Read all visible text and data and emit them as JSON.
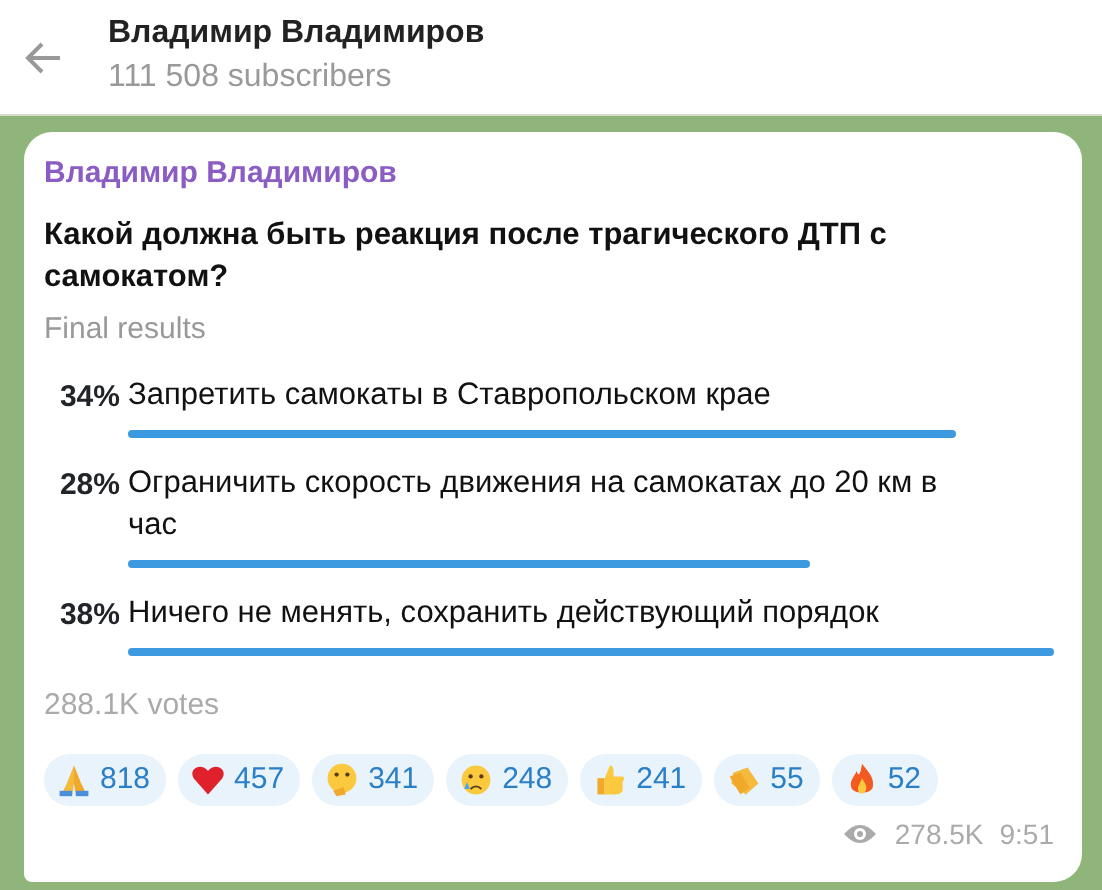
{
  "header": {
    "title": "Владимир Владимиров",
    "subtitle": "111 508 subscribers"
  },
  "message": {
    "author": "Владимир Владимиров",
    "question": "Какой должна быть реакция после трагического ДТП с самокатом?",
    "status": "Final results",
    "options": [
      {
        "percent": "34%",
        "text": "Запретить самокаты в Ставропольском крае"
      },
      {
        "percent": "28%",
        "text": "Ограничить скорость движения на самокатах до 20 км в час"
      },
      {
        "percent": "38%",
        "text": "Ничего не менять, сохранить действующий порядок"
      }
    ],
    "votes": "288.1K votes",
    "reactions": [
      {
        "kind": "pray",
        "count": "818"
      },
      {
        "kind": "heart",
        "count": "457"
      },
      {
        "kind": "thinking",
        "count": "341"
      },
      {
        "kind": "crying",
        "count": "248"
      },
      {
        "kind": "thumbs-up",
        "count": "241"
      },
      {
        "kind": "clap",
        "count": "55"
      },
      {
        "kind": "fire",
        "count": "52"
      }
    ],
    "views": "278.5K",
    "time": "9:51"
  }
}
